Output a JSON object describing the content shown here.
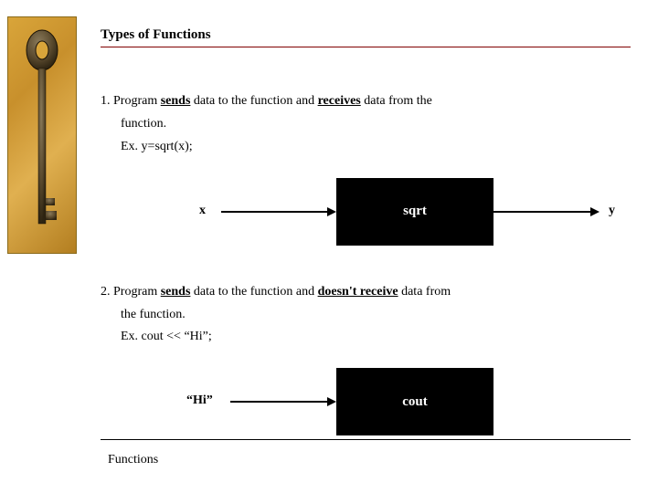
{
  "title": "Types of Functions",
  "section1": {
    "line1_pre": "1. Program ",
    "line1_u1": "sends",
    "line1_mid": " data to the function and ",
    "line1_u2": "receives",
    "line1_post": " data from the",
    "line2": "function.",
    "line3": "Ex. y=sqrt(x);"
  },
  "diagram1": {
    "left_label": "x",
    "box_label": "sqrt",
    "right_label": "y"
  },
  "section2": {
    "line1_pre": "2. Program ",
    "line1_u1": "sends",
    "line1_mid": " data to the function and ",
    "line1_u2": "doesn't receive",
    "line1_post": " data from",
    "line2": "the function.",
    "line3": "Ex. cout << “Hi”;"
  },
  "diagram2": {
    "left_label": "“Hi”",
    "box_label": "cout"
  },
  "footer": "Functions"
}
